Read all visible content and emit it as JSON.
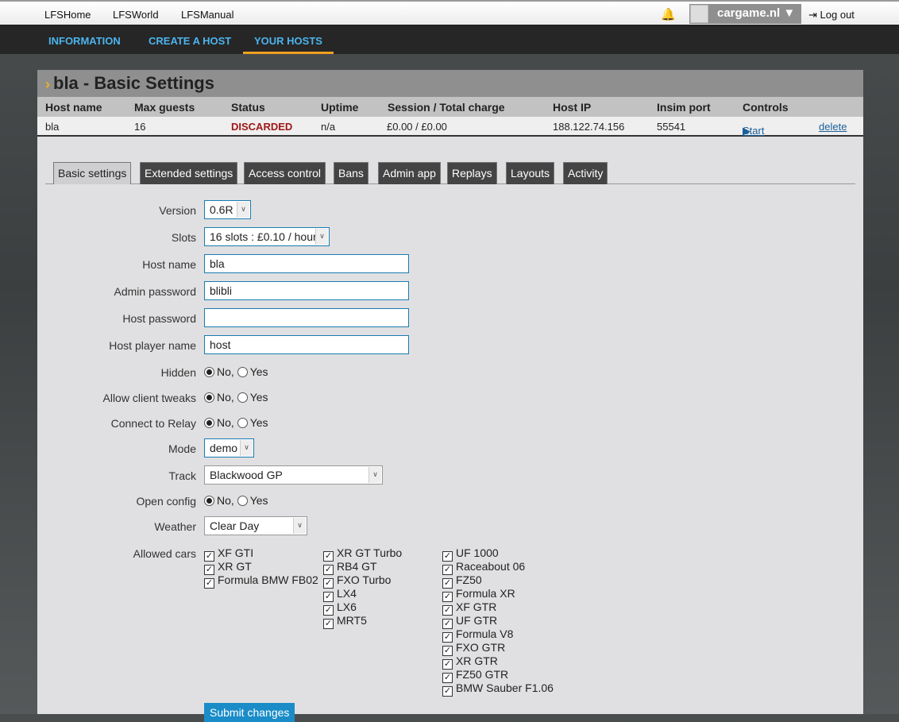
{
  "topbar": {
    "links": [
      "LFSHome",
      "LFSWorld",
      "LFSManual"
    ],
    "user": "cargame.nl ▼",
    "logout": "Log out"
  },
  "nav": {
    "items": [
      "INFORMATION",
      "CREATE A HOST",
      "YOUR HOSTS"
    ],
    "active": "YOUR HOSTS"
  },
  "panel": {
    "title": "bla - Basic Settings"
  },
  "table": {
    "headers": [
      "Host name",
      "Max guests",
      "Status",
      "Uptime",
      "Session / Total charge",
      "Host IP",
      "Insim port",
      "Controls"
    ],
    "row": {
      "host_name": "bla",
      "max_guests": "16",
      "status": "DISCARDED",
      "uptime": "n/a",
      "charge": "£0.00 / £0.00",
      "ip": "188.122.74.156",
      "port": "55541",
      "start": "Start",
      "delete": "delete"
    }
  },
  "tabs": [
    "Basic settings",
    "Extended settings",
    "Access control",
    "Bans",
    "Admin app",
    "Replays",
    "Layouts",
    "Activity"
  ],
  "form": {
    "version": {
      "label": "Version",
      "value": "0.6R"
    },
    "slots": {
      "label": "Slots",
      "value": "16 slots : £0.10 / hour"
    },
    "host_name": {
      "label": "Host name",
      "value": "bla"
    },
    "admin_password": {
      "label": "Admin password",
      "value": "blibli"
    },
    "host_password": {
      "label": "Host password",
      "value": ""
    },
    "host_player_name": {
      "label": "Host player name",
      "value": "host"
    },
    "hidden": {
      "label": "Hidden",
      "no": "No,",
      "yes": "Yes",
      "selected": "No"
    },
    "client_tweaks": {
      "label": "Allow client tweaks",
      "no": "No,",
      "yes": "Yes",
      "selected": "No"
    },
    "relay": {
      "label": "Connect to Relay",
      "no": "No,",
      "yes": "Yes",
      "selected": "No"
    },
    "mode": {
      "label": "Mode",
      "value": "demo"
    },
    "track": {
      "label": "Track",
      "value": "Blackwood GP"
    },
    "open_config": {
      "label": "Open config",
      "no": "No,",
      "yes": "Yes",
      "selected": "No"
    },
    "weather": {
      "label": "Weather",
      "value": "Clear Day"
    },
    "allowed_cars": {
      "label": "Allowed cars",
      "columns": [
        [
          "XF GTI",
          "XR GT",
          "Formula BMW FB02"
        ],
        [
          "XR GT Turbo",
          "RB4 GT",
          "FXO Turbo",
          "LX4",
          "LX6",
          "MRT5"
        ],
        [
          "UF 1000",
          "Raceabout 06",
          "FZ50",
          "Formula XR",
          "XF GTR",
          "UF GTR",
          "Formula V8",
          "FXO GTR",
          "XR GTR",
          "FZ50 GTR",
          "BMW Sauber F1.06"
        ]
      ]
    },
    "submit": "Submit changes"
  }
}
